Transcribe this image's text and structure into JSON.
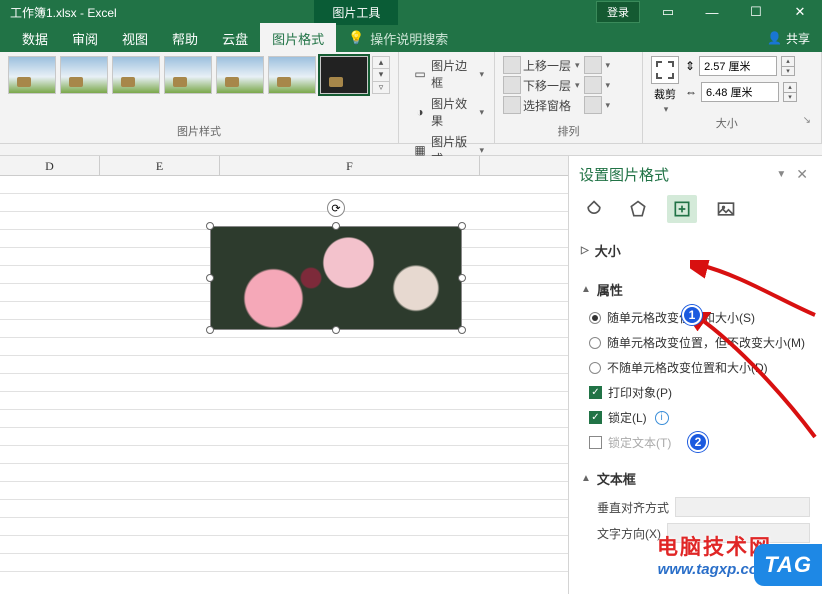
{
  "title": {
    "filename": "工作簿1.xlsx",
    "app": "Excel",
    "sep": " - "
  },
  "titlebar": {
    "tool_tab": "图片工具",
    "login": "登录"
  },
  "tabs": {
    "items": [
      "数据",
      "审阅",
      "视图",
      "帮助",
      "云盘"
    ],
    "active": "图片格式",
    "tell_me": "操作说明搜索",
    "share": "共享"
  },
  "ribbon": {
    "styles_label": "图片样式",
    "pic_border": "图片边框",
    "pic_effects": "图片效果",
    "pic_layout": "图片版式",
    "arrange": {
      "forward": "上移一层",
      "backward": "下移一层",
      "selection": "选择窗格",
      "label": "排列"
    },
    "size": {
      "crop": "裁剪",
      "height": "2.57 厘米",
      "width": "6.48 厘米",
      "label": "大小"
    }
  },
  "columns": [
    "D",
    "E",
    "F"
  ],
  "pane": {
    "title": "设置图片格式",
    "size_section": "大小",
    "props_section": "属性",
    "opt1": "随单元格改变位置和大小(S)",
    "opt2": "随单元格改变位置，但不改变大小(M)",
    "opt3": "不随单元格改变位置和大小(D)",
    "print": "打印对象(P)",
    "lock": "锁定(L)",
    "lock_text": "锁定文本(T)",
    "textbox_section": "文本框",
    "vert_align": "垂直对齐方式",
    "text_dir": "文字方向(X)"
  },
  "watermark": {
    "line1": "电脑技术网",
    "line2": "www.tagxp.com",
    "tag": "TAG"
  },
  "badges": {
    "n1": "1",
    "n2": "2"
  }
}
